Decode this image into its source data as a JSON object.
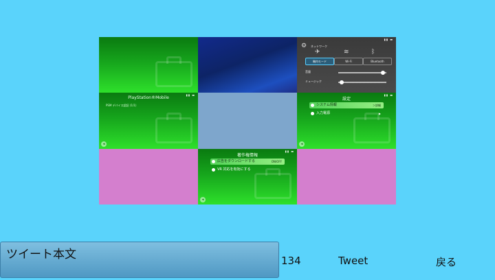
{
  "screens": {
    "playstation_mobile_title": "PlayStation®Mobile",
    "playstation_mobile_line": "PSM デバイス認証 (1/1)",
    "settings_title": "設定",
    "settings_items": [
      {
        "label": "システム情報",
        "right": "＞詳細"
      },
      {
        "label": "入力電源",
        "right": "▶"
      }
    ],
    "license_title": "著作権情報",
    "license_items": [
      {
        "label": "広告をダウンロードする",
        "right": "ON/OFF"
      },
      {
        "label": "VR 対応を有効にする",
        "right": ""
      }
    ],
    "control_panel": {
      "title": "ネットワーク",
      "buttons": [
        "機内モード",
        "Wi-Fi",
        "Bluetooth"
      ],
      "vol_label": "音量",
      "music_label": "ミュージック"
    }
  },
  "tweet": {
    "placeholder": "ツイート本文",
    "count": "134",
    "submit_label": "Tweet",
    "back_label": "戻る"
  }
}
